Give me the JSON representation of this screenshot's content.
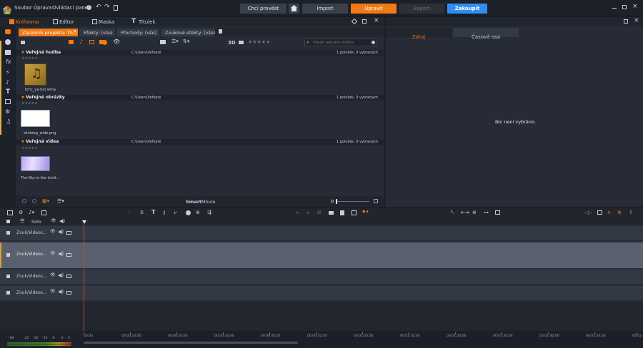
{
  "menu": [
    "Soubor",
    "Úprava",
    "Ovládací panel"
  ],
  "top_buttons": {
    "chci_provest": "Chci provést",
    "import": "Import",
    "upravit": "Upravit",
    "export": "Export",
    "zakoupit": "Zakoupit"
  },
  "main_tabs": [
    "Knihovna",
    "Editor",
    "Maska",
    "Titulek"
  ],
  "library": {
    "sub_tabs": [
      "Zásobník projektu: Th...",
      "Efekty: (vše)",
      "Přechody: (vše)",
      "Zvukové efekty: (vše)"
    ],
    "toolbar_3d": "3D",
    "rating": "★★★★★",
    "search_placeholder": "Hledat aktuální měření",
    "sections": [
      {
        "title": "Veřejná hudba",
        "path": "C:\\Users\\Veřejné",
        "count": "1 položek, 0 vybraných",
        "rating": "★★★★★",
        "item": "bmc_ya-hat.wma"
      },
      {
        "title": "Veřejné obrázky",
        "path": "C:\\Users\\Veřejné",
        "count": "1 položek, 0 vybraných",
        "rating": "★★★★★",
        "item": "whitebg_wide.png"
      },
      {
        "title": "Veřejná videa",
        "path": "C:\\Users\\Veřejné",
        "count": "1 položek, 0 vybraných",
        "rating": "★★★★★",
        "item": "The-Sky-is-the-Limit..."
      }
    ],
    "footer": {
      "smartmovie_bold": "Smart",
      "smartmovie_rest": "Movie"
    }
  },
  "preview": {
    "tabs": [
      "Zdroj",
      "Časová osa"
    ],
    "empty_message": "Nic není vybráno."
  },
  "timeline": {
    "solo_label": "Sólo",
    "tracks": [
      "Zvuk/Videos...",
      "Zvuk/Videos...",
      "Zvuk/Videos...",
      "Zvuk/Videos..."
    ],
    "ruler": [
      "00:00",
      "00:00:10;00",
      "00:00:20;00",
      "00:00:30;00",
      "00:00:40;00",
      "00:00:50;00",
      "00:01:00;00",
      "00:01:10;00",
      "00:01:20;00",
      "00:01:30;00",
      "00:01:40;00",
      "00:01:50;00",
      "00:02"
    ],
    "meter_labels": [
      "-60",
      "-22",
      "-16",
      "-10",
      "-6",
      "-3",
      "0"
    ]
  },
  "colors": {
    "accent": "#f07a14",
    "zakoupit": "#2f8ff0",
    "bg": "#1b1f27",
    "panel": "#262b35",
    "selected_track": "#5a606d"
  }
}
